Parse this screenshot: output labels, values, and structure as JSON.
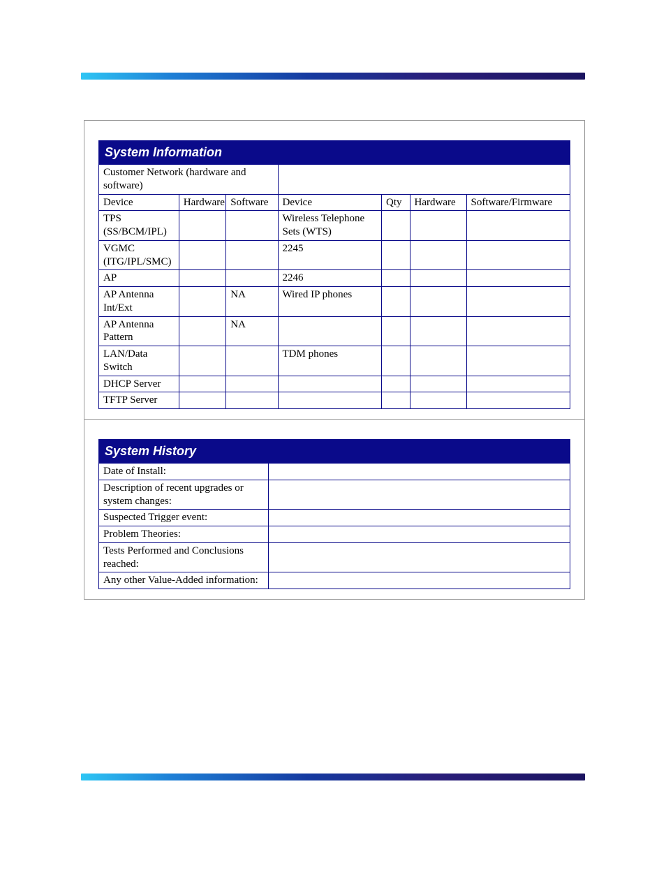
{
  "systemInformation": {
    "title": "System Information",
    "subheader": "Customer Network (hardware and software)",
    "left": {
      "headers": {
        "device": "Device",
        "hardware": "Hardware",
        "software": "Software"
      },
      "rows": [
        {
          "device": "TPS (SS/BCM/IPL)",
          "hardware": "",
          "software": ""
        },
        {
          "device": "VGMC (ITG/IPL/SMC)",
          "hardware": "",
          "software": ""
        },
        {
          "device": "AP",
          "hardware": "",
          "software": ""
        },
        {
          "device": "AP Antenna Int/Ext",
          "hardware": "",
          "software": "NA"
        },
        {
          "device": "AP Antenna Pattern",
          "hardware": "",
          "software": "NA"
        },
        {
          "device": "LAN/Data Switch",
          "hardware": "",
          "software": ""
        },
        {
          "device": "DHCP Server",
          "hardware": "",
          "software": ""
        },
        {
          "device": "TFTP Server",
          "hardware": "",
          "software": ""
        }
      ]
    },
    "right": {
      "headers": {
        "device": "Device",
        "qty": "Qty",
        "hardware": "Hardware",
        "softwareFirmware": "Software/Firmware"
      },
      "rows": [
        {
          "device": "Wireless Telephone Sets (WTS)",
          "qty": "",
          "hardware": "",
          "softwareFirmware": ""
        },
        {
          "device": "2245",
          "qty": "",
          "hardware": "",
          "softwareFirmware": ""
        },
        {
          "device": "2246",
          "qty": "",
          "hardware": "",
          "softwareFirmware": ""
        },
        {
          "device": "Wired IP phones",
          "qty": "",
          "hardware": "",
          "softwareFirmware": ""
        },
        {
          "device": "",
          "qty": "",
          "hardware": "",
          "softwareFirmware": ""
        },
        {
          "device": "TDM phones",
          "qty": "",
          "hardware": "",
          "softwareFirmware": ""
        },
        {
          "device": "",
          "qty": "",
          "hardware": "",
          "softwareFirmware": ""
        },
        {
          "device": "",
          "qty": "",
          "hardware": "",
          "softwareFirmware": ""
        }
      ]
    }
  },
  "systemHistory": {
    "title": "System History",
    "rows": [
      {
        "label": "Date of Install:",
        "value": ""
      },
      {
        "label": "Description of recent upgrades or system changes:",
        "value": ""
      },
      {
        "label": "Suspected Trigger event:",
        "value": ""
      },
      {
        "label": "Problem Theories:",
        "value": ""
      },
      {
        "label": "Tests Performed and Conclusions reached:",
        "value": ""
      },
      {
        "label": "Any other Value-Added information:",
        "value": ""
      }
    ]
  }
}
